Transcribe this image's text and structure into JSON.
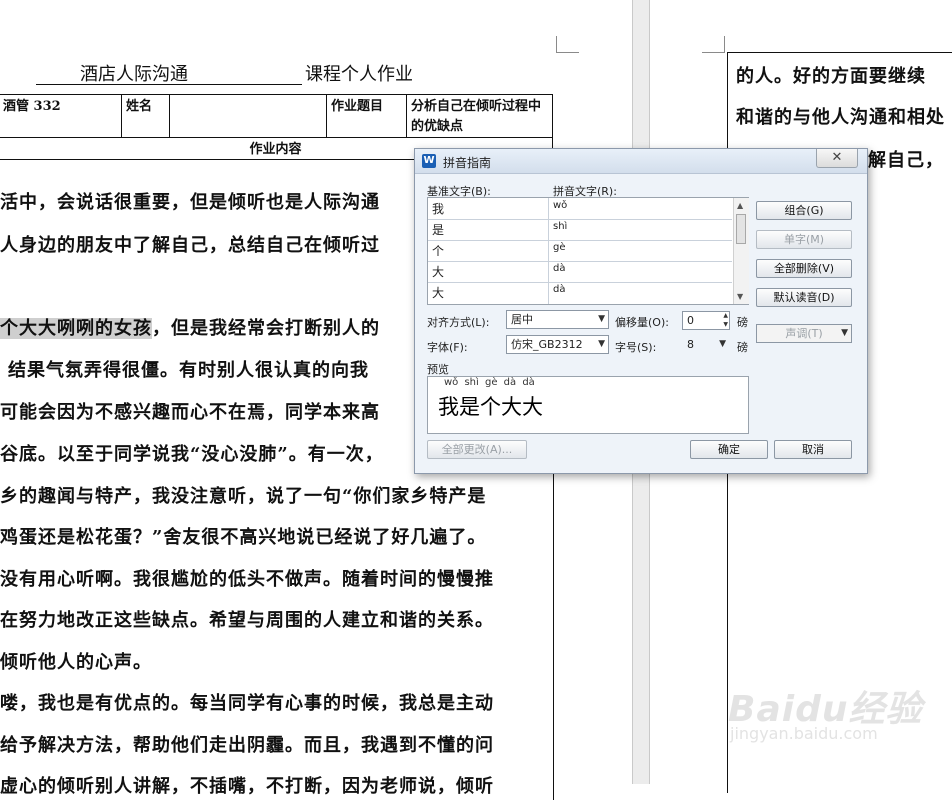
{
  "document": {
    "title_main": "酒店人际沟通",
    "title_suffix": "课程个人作业",
    "header": {
      "class_value": "酒管 332",
      "name_label": "姓名",
      "topic_label": "作业题目",
      "topic_value": "分析自己在倾听过程中的优缺点",
      "content_label": "作业内容"
    },
    "lines": [
      "活中，会说话很重要，但是倾听也是人际沟通",
      "人身边的朋友中了解自己，总结自己在倾听过",
      "个大大咧咧的女孩",
      "，但是我经常会打断别人的",
      "结果气氛弄得很僵。有时别人很认真的向我",
      "可能会因为不感兴趣而心不在焉，同学本来高",
      "谷底。以至于同学说我“没心没肺”。有一次，",
      "乡的趣闻与特产，我没注意听，说了一句“你们家乡特产是",
      "鸡蛋还是松花蛋？”舍友很不高兴地说已经说了好几遍了。",
      "没有用心听啊。我很尴尬的低头不做声。随着时间的慢慢推",
      "在努力地改正这些缺点。希望与周围的人建立和谐的关系。",
      "倾听他人的心声。",
      "喽，我也是有优点的。每当同学有心事的时候，我总是主动",
      "给予解决方法，帮助他们走出阴霾。而且，我遇到不懂的问",
      "虚心的倾听别人讲解，不插嘴，不打断，因为老师说，倾听"
    ],
    "right_lines": [
      "的人。好的方面要继续",
      "和谐的与他人沟通和相处",
      "解自己，"
    ]
  },
  "dialog": {
    "title": "拼音指南",
    "app_icon_letter": "W",
    "close_symbol": "✕",
    "base_label": "基准文字(B):",
    "pinyin_label": "拼音文字(R):",
    "rows": [
      {
        "base": "我",
        "pinyin": "wǒ"
      },
      {
        "base": "是",
        "pinyin": "shì"
      },
      {
        "base": "个",
        "pinyin": "gè"
      },
      {
        "base": "大",
        "pinyin": "dà"
      },
      {
        "base": "大",
        "pinyin": "dà"
      }
    ],
    "buttons": {
      "combine": "组合(G)",
      "single": "单字(M)",
      "delete_all": "全部删除(V)",
      "default_reading": "默认读音(D)",
      "tone": "声调(T)",
      "change_all": "全部更改(A)...",
      "ok": "确定",
      "cancel": "取消"
    },
    "align_label": "对齐方式(L):",
    "align_value": "居中",
    "offset_label": "偏移量(O):",
    "offset_value": "0",
    "unit": "磅",
    "font_label": "字体(F):",
    "font_value": "仿宋_GB2312",
    "size_label": "字号(S):",
    "size_value": "8",
    "preview_label": "预览",
    "preview_pinyin": "wǒ shì gè dà dà",
    "preview_text": "我是个大大"
  },
  "watermark": {
    "brand": "Baidu经验",
    "url": "jingyan.baidu.com"
  }
}
